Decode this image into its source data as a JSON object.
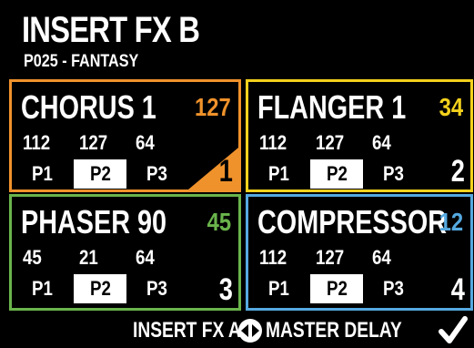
{
  "header": {
    "title": "INSERT FX B",
    "subtitle": "P025 - FANTASY"
  },
  "slots": [
    {
      "name": "CHORUS 1",
      "value": "127",
      "value_color": "#f0922b",
      "params": [
        "112",
        "127",
        "64"
      ],
      "tabs": [
        "P1",
        "P2",
        "P3"
      ],
      "active_tab": "P2",
      "number": "1",
      "border_color": "#f0922b"
    },
    {
      "name": "FLANGER 1",
      "value": "34",
      "value_color": "#f3d11c",
      "params": [
        "112",
        "127",
        "64"
      ],
      "tabs": [
        "P1",
        "P2",
        "P3"
      ],
      "active_tab": "P2",
      "number": "2",
      "border_color": "#f3d11c"
    },
    {
      "name": "PHASER 90",
      "value": "45",
      "value_color": "#6ab44c",
      "params": [
        "45",
        "21",
        "64"
      ],
      "tabs": [
        "P1",
        "P2",
        "P3"
      ],
      "active_tab": "P2",
      "number": "3",
      "border_color": "#6ab44c"
    },
    {
      "name": "COMPRESSOR",
      "value": "12",
      "value_color": "#55a9e0",
      "params": [
        "112",
        "127",
        "64"
      ],
      "tabs": [
        "P1",
        "P2",
        "P3"
      ],
      "active_tab": "P2",
      "number": "4",
      "border_color": "#55a9e0"
    }
  ],
  "footer": {
    "prev_label": "INSERT FX A",
    "next_label": "MASTER DELAY",
    "nav_icon": "left-right-arrows-icon",
    "confirm_icon": "checkmark-icon"
  }
}
